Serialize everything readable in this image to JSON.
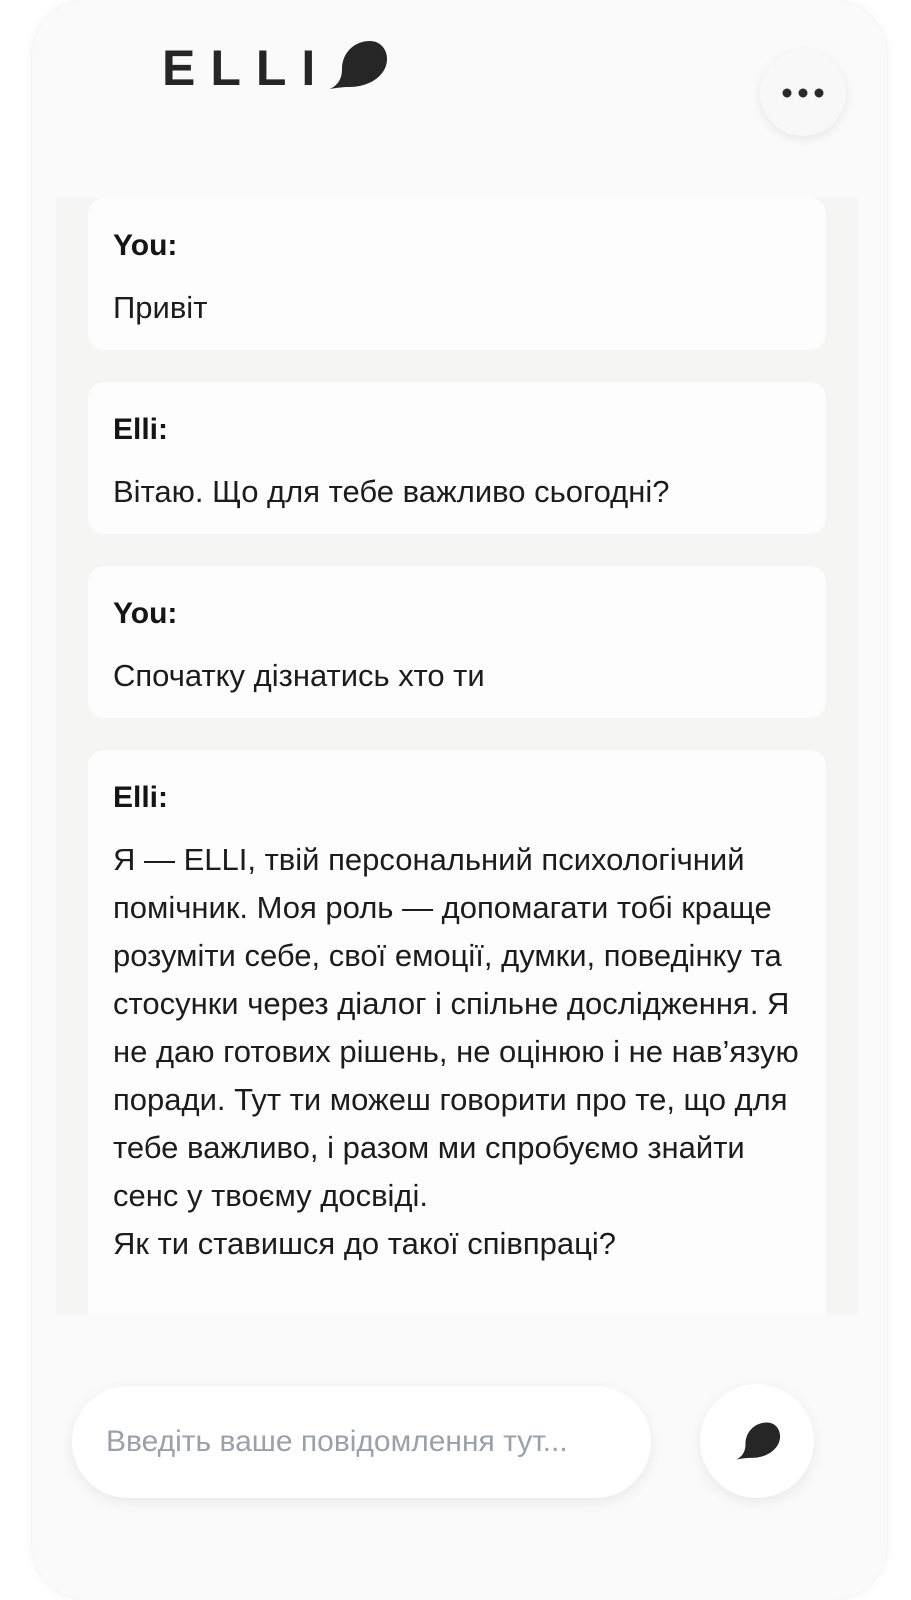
{
  "header": {
    "logo_text": "ELLI",
    "menu_icon": "more-horizontal-icon"
  },
  "messages": [
    {
      "author": "You:",
      "text": "Привіт"
    },
    {
      "author": "Elli:",
      "text": "Вітаю. Що для тебе важливо сьогодні?"
    },
    {
      "author": "You:",
      "text": "Спочатку дізнатись хто ти"
    },
    {
      "author": "Elli:",
      "text": "Я — ELLI, твій персональний психологічний помічник. Моя роль — допомагати тобі краще розуміти себе, свої емоції, думки, поведінку та стосунки через діалог і спільне дослідження. Я не даю готових рішень, не оцінюю і не нав’язую поради. Тут ти можеш говорити про те, що для тебе важливо, і разом ми спробуємо знайти сенс у твоєму досвіді.\nЯк ти ставишся до такої співпраці?"
    }
  ],
  "composer": {
    "placeholder": "Введіть ваше повідомлення тут...",
    "value": "",
    "send_icon": "speech-bubble-send-icon"
  },
  "colors": {
    "brand_dark": "#262626",
    "chat_background": "#f5f5f4",
    "bubble_background": "#fdfdfd",
    "placeholder": "#9aa1ab"
  }
}
